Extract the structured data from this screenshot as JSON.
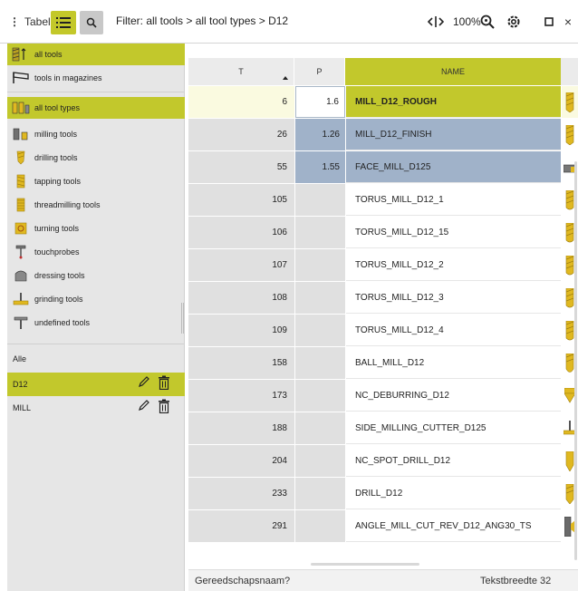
{
  "toolbar": {
    "table_label": "Tabel",
    "filter_text": "Filter: all tools > all tool types > D12",
    "zoom": "100%"
  },
  "icons": {
    "table": "more-vert-icon",
    "list": "list-icon",
    "search": "search-icon",
    "split": "split-view-icon",
    "zoom": "zoom-icon",
    "settings": "gear-icon",
    "maximize": "maximize-icon",
    "close": "close-icon"
  },
  "sidebar": {
    "groups": [
      {
        "label": "all tools",
        "icon": "all-tools-icon",
        "selected": true
      },
      {
        "label": "tools in magazines",
        "icon": "magazine-icon",
        "selected": false
      }
    ],
    "types": [
      {
        "label": "all tool types",
        "icon": "all-tool-types-icon",
        "selected": true
      },
      {
        "label": "milling tools",
        "icon": "milling-tool-icon"
      },
      {
        "label": "drilling tools",
        "icon": "drill-icon"
      },
      {
        "label": "tapping tools",
        "icon": "tap-icon"
      },
      {
        "label": "threadmilling tools",
        "icon": "threadmill-icon"
      },
      {
        "label": "turning tools",
        "icon": "turning-tool-icon"
      },
      {
        "label": "touchprobes",
        "icon": "touchprobe-icon"
      },
      {
        "label": "dressing tools",
        "icon": "dressing-tool-icon"
      },
      {
        "label": "grinding tools",
        "icon": "grinding-tool-icon"
      },
      {
        "label": "undefined tools",
        "icon": "undefined-tool-icon"
      }
    ],
    "filters": [
      {
        "label": "Alle",
        "selected": false,
        "editable": false
      },
      {
        "label": "D12",
        "selected": true,
        "editable": true
      },
      {
        "label": "MILL",
        "selected": false,
        "editable": true
      }
    ]
  },
  "table": {
    "columns": [
      "T",
      "P",
      "NAME"
    ],
    "sort_column": "T",
    "rows": [
      {
        "t": "6",
        "p": "1.6",
        "name": "MILL_D12_ROUGH",
        "state": "active",
        "icon": "end-mill-icon"
      },
      {
        "t": "26",
        "p": "1.26",
        "name": "MILL_D12_FINISH",
        "state": "marked",
        "icon": "end-mill-icon"
      },
      {
        "t": "55",
        "p": "1.55",
        "name": "FACE_MILL_D125",
        "state": "marked",
        "icon": "face-mill-icon"
      },
      {
        "t": "105",
        "p": "",
        "name": "TORUS_MILL_D12_1",
        "state": "",
        "icon": "torus-mill-icon"
      },
      {
        "t": "106",
        "p": "",
        "name": "TORUS_MILL_D12_15",
        "state": "",
        "icon": "torus-mill-icon"
      },
      {
        "t": "107",
        "p": "",
        "name": "TORUS_MILL_D12_2",
        "state": "",
        "icon": "torus-mill-icon"
      },
      {
        "t": "108",
        "p": "",
        "name": "TORUS_MILL_D12_3",
        "state": "",
        "icon": "torus-mill-icon"
      },
      {
        "t": "109",
        "p": "",
        "name": "TORUS_MILL_D12_4",
        "state": "",
        "icon": "torus-mill-icon"
      },
      {
        "t": "158",
        "p": "",
        "name": "BALL_MILL_D12",
        "state": "",
        "icon": "ball-mill-icon"
      },
      {
        "t": "173",
        "p": "",
        "name": "NC_DEBURRING_D12",
        "state": "",
        "icon": "deburring-icon"
      },
      {
        "t": "188",
        "p": "",
        "name": "SIDE_MILLING_CUTTER_D125",
        "state": "",
        "icon": "side-cutter-icon"
      },
      {
        "t": "204",
        "p": "",
        "name": "NC_SPOT_DRILL_D12",
        "state": "",
        "icon": "spot-drill-icon"
      },
      {
        "t": "233",
        "p": "",
        "name": "DRILL_D12",
        "state": "",
        "icon": "drill-icon"
      },
      {
        "t": "291",
        "p": "",
        "name": "ANGLE_MILL_CUT_REV_D12_ANG30_TS",
        "state": "",
        "icon": "angle-mill-icon"
      }
    ]
  },
  "status": {
    "field": "Gereedschapsnaam?",
    "width": "Tekstbreedte 32"
  },
  "colors": {
    "accent": "#c2c82c",
    "marked": "#a0b2c9",
    "tool_yellow": "#e0b820"
  }
}
